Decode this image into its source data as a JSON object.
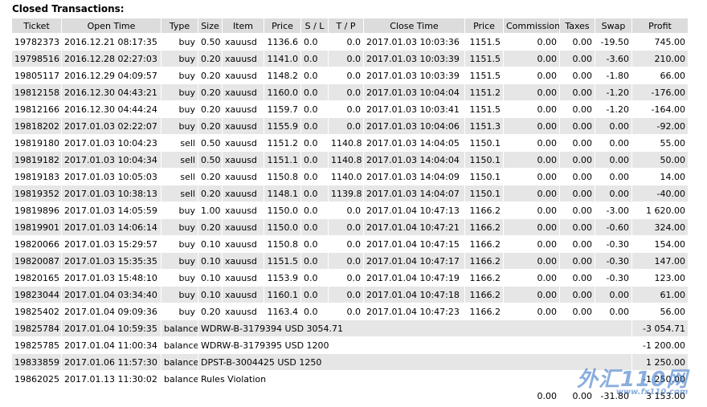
{
  "title": "Closed Transactions:",
  "columns": [
    "Ticket",
    "Open Time",
    "Type",
    "Size",
    "Item",
    "Price",
    "S / L",
    "T / P",
    "Close Time",
    "Price",
    "Commission",
    "Taxes",
    "Swap",
    "Profit"
  ],
  "trades": [
    [
      "19782373",
      "2016.12.21 08:17:35",
      "buy",
      "0.50",
      "xauusd",
      "1136.6",
      "0.0",
      "0.0",
      "2017.01.03 10:03:36",
      "1151.5",
      "0.00",
      "0.00",
      "-19.50",
      "745.00"
    ],
    [
      "19798516",
      "2016.12.28 02:27:03",
      "buy",
      "0.20",
      "xauusd",
      "1141.0",
      "0.0",
      "0.0",
      "2017.01.03 10:03:39",
      "1151.5",
      "0.00",
      "0.00",
      "-3.60",
      "210.00"
    ],
    [
      "19805117",
      "2016.12.29 04:09:57",
      "buy",
      "0.20",
      "xauusd",
      "1148.2",
      "0.0",
      "0.0",
      "2017.01.03 10:03:39",
      "1151.5",
      "0.00",
      "0.00",
      "-1.80",
      "66.00"
    ],
    [
      "19812158",
      "2016.12.30 04:43:21",
      "buy",
      "0.20",
      "xauusd",
      "1160.0",
      "0.0",
      "0.0",
      "2017.01.03 10:04:04",
      "1151.2",
      "0.00",
      "0.00",
      "-1.20",
      "-176.00"
    ],
    [
      "19812166",
      "2016.12.30 04:44:24",
      "buy",
      "0.20",
      "xauusd",
      "1159.7",
      "0.0",
      "0.0",
      "2017.01.03 10:03:41",
      "1151.5",
      "0.00",
      "0.00",
      "-1.20",
      "-164.00"
    ],
    [
      "19818202",
      "2017.01.03 02:22:07",
      "buy",
      "0.20",
      "xauusd",
      "1155.9",
      "0.0",
      "0.0",
      "2017.01.03 10:04:06",
      "1151.3",
      "0.00",
      "0.00",
      "0.00",
      "-92.00"
    ],
    [
      "19819180",
      "2017.01.03 10:04:23",
      "sell",
      "0.50",
      "xauusd",
      "1151.2",
      "0.0",
      "1140.8",
      "2017.01.03 14:04:05",
      "1150.1",
      "0.00",
      "0.00",
      "0.00",
      "55.00"
    ],
    [
      "19819182",
      "2017.01.03 10:04:34",
      "sell",
      "0.50",
      "xauusd",
      "1151.1",
      "0.0",
      "1140.8",
      "2017.01.03 14:04:04",
      "1150.1",
      "0.00",
      "0.00",
      "0.00",
      "50.00"
    ],
    [
      "19819183",
      "2017.01.03 10:05:03",
      "sell",
      "0.20",
      "xauusd",
      "1150.8",
      "0.0",
      "1140.0",
      "2017.01.03 14:04:09",
      "1150.1",
      "0.00",
      "0.00",
      "0.00",
      "14.00"
    ],
    [
      "19819352",
      "2017.01.03 10:38:13",
      "sell",
      "0.20",
      "xauusd",
      "1148.1",
      "0.0",
      "1139.8",
      "2017.01.03 14:04:07",
      "1150.1",
      "0.00",
      "0.00",
      "0.00",
      "-40.00"
    ],
    [
      "19819896",
      "2017.01.03 14:05:59",
      "buy",
      "1.00",
      "xauusd",
      "1150.0",
      "0.0",
      "0.0",
      "2017.01.04 10:47:13",
      "1166.2",
      "0.00",
      "0.00",
      "-3.00",
      "1 620.00"
    ],
    [
      "19819901",
      "2017.01.03 14:06:14",
      "buy",
      "0.20",
      "xauusd",
      "1150.0",
      "0.0",
      "0.0",
      "2017.01.04 10:47:21",
      "1166.2",
      "0.00",
      "0.00",
      "-0.60",
      "324.00"
    ],
    [
      "19820066",
      "2017.01.03 15:29:57",
      "buy",
      "0.10",
      "xauusd",
      "1150.8",
      "0.0",
      "0.0",
      "2017.01.04 10:47:15",
      "1166.2",
      "0.00",
      "0.00",
      "-0.30",
      "154.00"
    ],
    [
      "19820087",
      "2017.01.03 15:35:35",
      "buy",
      "0.10",
      "xauusd",
      "1151.5",
      "0.0",
      "0.0",
      "2017.01.04 10:47:17",
      "1166.2",
      "0.00",
      "0.00",
      "-0.30",
      "147.00"
    ],
    [
      "19820165",
      "2017.01.03 15:48:10",
      "buy",
      "0.10",
      "xauusd",
      "1153.9",
      "0.0",
      "0.0",
      "2017.01.04 10:47:19",
      "1166.2",
      "0.00",
      "0.00",
      "-0.30",
      "123.00"
    ],
    [
      "19823044",
      "2017.01.04 03:34:40",
      "buy",
      "0.10",
      "xauusd",
      "1160.1",
      "0.0",
      "0.0",
      "2017.01.04 10:47:18",
      "1166.2",
      "0.00",
      "0.00",
      "0.00",
      "61.00"
    ],
    [
      "19825402",
      "2017.01.04 09:09:36",
      "buy",
      "0.20",
      "xauusd",
      "1163.4",
      "0.0",
      "0.0",
      "2017.01.04 10:47:23",
      "1166.2",
      "0.00",
      "0.00",
      "0.00",
      "56.00"
    ]
  ],
  "balances": [
    [
      "19825784",
      "2017.01.04 10:59:35",
      "balance",
      "WDRW-B-3179394 USD 3054.71",
      "-3 054.71"
    ],
    [
      "19825785",
      "2017.01.04 11:00:34",
      "balance",
      "WDRW-B-3179395 USD 1200",
      "-1 200.00"
    ],
    [
      "19833859",
      "2017.01.06 11:57:30",
      "balance",
      "DPST-B-3004425 USD 1250",
      "1 250.00"
    ],
    [
      "19862025",
      "2017.01.13 11:30:02",
      "balance",
      "Rules Violation",
      "-1 250.00"
    ]
  ],
  "totals": {
    "commission": "0.00",
    "taxes": "0.00",
    "swap": "-31.80",
    "profit": "3 153.00"
  },
  "watermark": {
    "main": "外汇110网",
    "sub": "www.fx110.com"
  }
}
